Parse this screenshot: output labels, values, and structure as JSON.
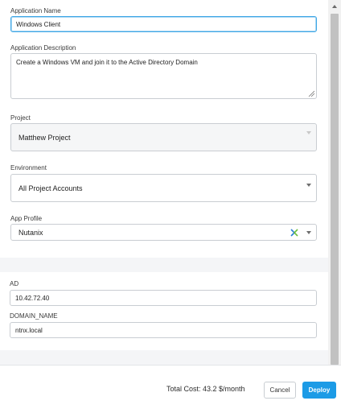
{
  "form": {
    "app_name_label": "Application Name",
    "app_name_value": "Windows Client",
    "app_desc_label": "Application Description",
    "app_desc_value": "Create a Windows VM and join it to the Active Directory Domain",
    "project_label": "Project",
    "project_value": "Matthew Project",
    "environment_label": "Environment",
    "environment_value": "All Project Accounts",
    "app_profile_label": "App Profile",
    "app_profile_value": "Nutanix"
  },
  "variables": {
    "ad_label": "AD",
    "ad_value": "10.42.72.40",
    "domain_label": "DOMAIN_NAME",
    "domain_value": "ntnx.local"
  },
  "footer": {
    "total_cost": "Total Cost: 43.2 $/month",
    "cancel_label": "Cancel",
    "deploy_label": "Deploy"
  },
  "colors": {
    "accent": "#1c9be6",
    "focus_border": "#3fa7e6"
  },
  "icons": {
    "app_profile_logo": "nutanix-logo-icon",
    "dropdown": "caret-down-icon",
    "scroll_up": "scroll-up-arrow-icon",
    "resize": "resize-grip-icon"
  }
}
